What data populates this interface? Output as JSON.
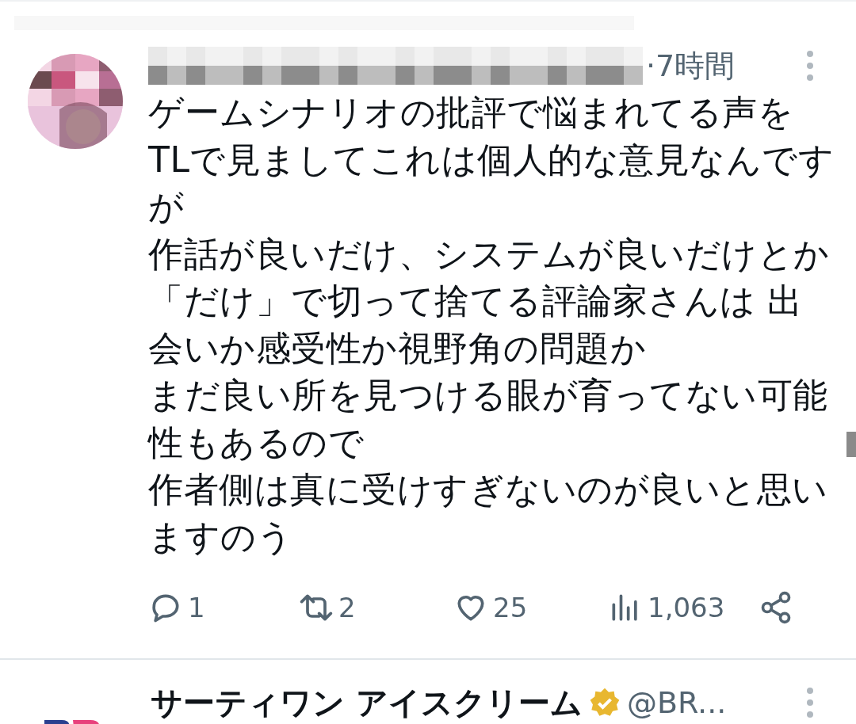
{
  "tweet": {
    "time": "·7時間",
    "paragraphs": [
      "ゲームシナリオの批評で悩まれてる声をTLで見ましてこれは個人的な意見なんですが",
      "作話が良いだけ、システムが良いだけとか「だけ」で切って捨てる評論家さんは 出会いか感受性か視野角の問題か",
      "まだ良い所を見つける眼が育ってない可能性もあるので",
      "作者側は真に受けすぎないのが良いと思いますのう"
    ],
    "actions": [
      {
        "kind": "reply",
        "count": "1"
      },
      {
        "kind": "retweet",
        "count": "2"
      },
      {
        "kind": "like",
        "count": "25"
      },
      {
        "kind": "views",
        "count": "1,063"
      },
      {
        "kind": "share"
      }
    ]
  },
  "next_tweet": {
    "name": "サーティワン アイスクリーム",
    "verified": true,
    "handle": "@BR..."
  }
}
